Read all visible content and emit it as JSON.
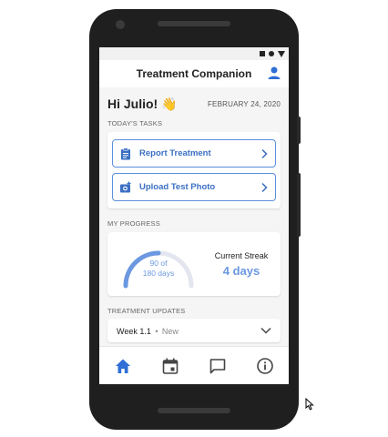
{
  "app": {
    "title": "Treatment Companion"
  },
  "header": {
    "greeting": "Hi Julio! 👋",
    "date": "FEBRUARY 24, 2020"
  },
  "tasks": {
    "section_label": "TODAY'S TASKS",
    "items": [
      {
        "label": "Report Treatment",
        "icon": "clipboard-icon"
      },
      {
        "label": "Upload Test Photo",
        "icon": "add-photo-icon"
      }
    ]
  },
  "progress": {
    "section_label": "MY PROGRESS",
    "completed_days": 90,
    "total_days": 180,
    "line1": "90 of",
    "line2": "180 days",
    "streak_label": "Current Streak",
    "streak_value": "4 days"
  },
  "updates": {
    "section_label": "TREATMENT UPDATES",
    "week": "Week 1.1",
    "separator": "•",
    "badge": "New"
  },
  "nav": {
    "items": [
      "home-icon",
      "calendar-icon",
      "chat-icon",
      "info-icon"
    ],
    "active": "home-icon"
  },
  "colors": {
    "accent": "#2f6fd6",
    "accent_light": "#6b98e0",
    "gauge_track": "#e3e6ef"
  }
}
